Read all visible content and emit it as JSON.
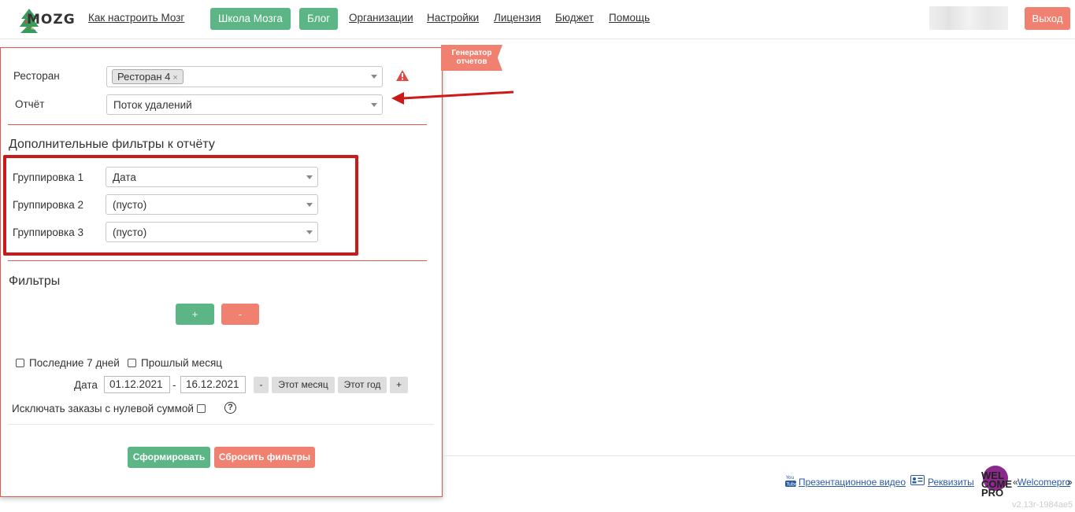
{
  "header": {
    "logo_text": "MOZG",
    "nav_how": "Как настроить Мозг",
    "school_button": "Школа Мозга",
    "blog_button": "Блог",
    "nav_links": [
      "Организации",
      "Настройки",
      "Лицензия",
      "Бюджет",
      "Помощь"
    ],
    "exit_button": "Выход"
  },
  "panel": {
    "ribbon": "Генератор отчетов",
    "restaurant_label": "Ресторан",
    "restaurant_tag": "Ресторан 4",
    "report_label": "Отчёт",
    "report_value": "Поток удалений",
    "extra_filters_title": "Дополнительные фильтры к отчёту",
    "groupings": [
      {
        "label": "Группировка 1",
        "value": "Дата"
      },
      {
        "label": "Группировка 2",
        "value": "(пусто)"
      },
      {
        "label": "Группировка 3",
        "value": "(пусто)"
      }
    ],
    "filters_title": "Фильтры",
    "add_filter": "+",
    "remove_filter": "-",
    "last7_label": "Последние 7 дней",
    "last_month_label": "Прошлый месяц",
    "date_label": "Дата",
    "date_from": "01.12.2021",
    "date_sep": "-",
    "date_to": "16.12.2021",
    "minus_btn": "-",
    "this_month_btn": "Этот месяц",
    "this_year_btn": "Этот год",
    "plus_btn": "+",
    "exclude_zero_label": "Исключать заказы с нулевой суммой",
    "help": "?",
    "generate_button": "Сформировать",
    "reset_button": "Сбросить фильтры"
  },
  "footer": {
    "video_link": "Презентационное видео",
    "requisites_link": "Реквизиты",
    "wp_logo_text": "WEL COME PRO",
    "welcomepro_prefix": "«",
    "welcomepro_link": "Welcomepro",
    "welcomepro_suffix": "»",
    "version": "v2.13r-1984ae5"
  },
  "colors": {
    "green": "#5cb584",
    "salmon": "#f08070",
    "highlight_red": "#cc1a1a",
    "divider_red": "#e05a50",
    "link_blue": "#2a5ba8"
  }
}
